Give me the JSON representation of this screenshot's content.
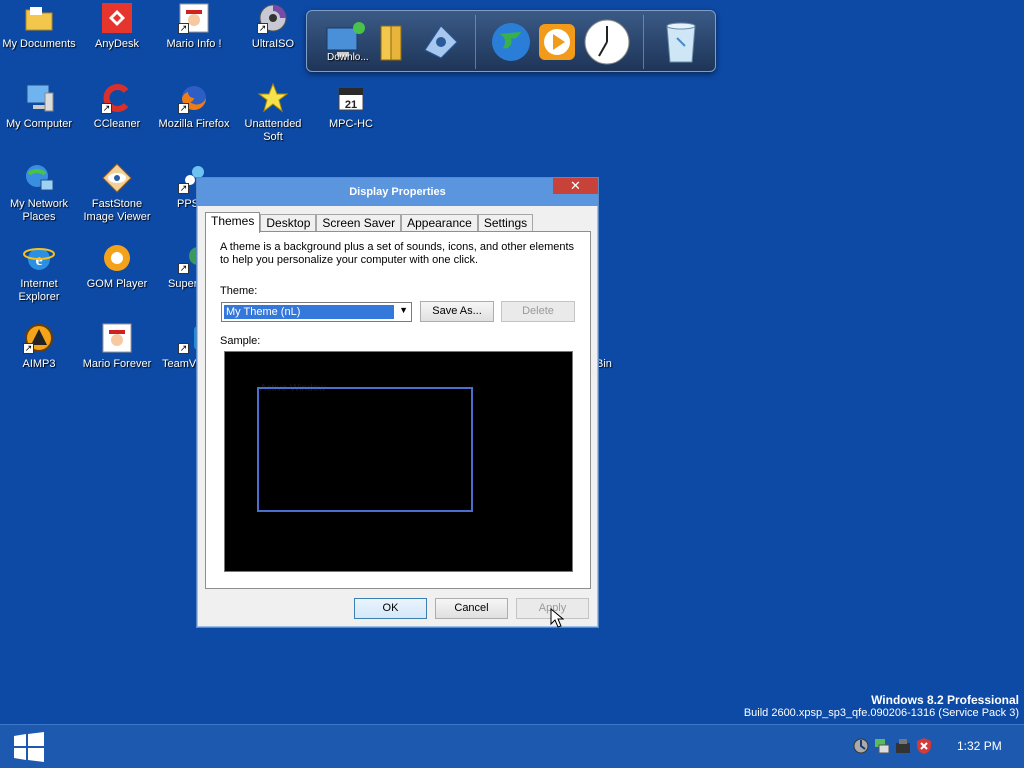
{
  "desktop": {
    "icons": [
      {
        "label": "My Documents",
        "icon": "folder-icon"
      },
      {
        "label": "AnyDesk",
        "icon": "anydesk-icon"
      },
      {
        "label": "Mario Info !",
        "icon": "mario-icon"
      },
      {
        "label": "UltraISO",
        "icon": "disc-icon"
      },
      {
        "label": "My Computer",
        "icon": "computer-icon"
      },
      {
        "label": "CCleaner",
        "icon": "ccleaner-icon"
      },
      {
        "label": "Mozilla Firefox",
        "icon": "firefox-icon"
      },
      {
        "label": "Unattended Soft",
        "icon": "star-icon"
      },
      {
        "label": "MPC-HC",
        "icon": "calendar-icon"
      },
      {
        "label": "My Network Places",
        "icon": "network-icon"
      },
      {
        "label": "FastStone Image Viewer",
        "icon": "eye-icon"
      },
      {
        "label": "PPS",
        "icon": "pps-icon"
      },
      {
        "label": "Internet Explorer",
        "icon": "ie-icon"
      },
      {
        "label": "GOM Player",
        "icon": "gom-icon"
      },
      {
        "label": "Super",
        "icon": "super-icon"
      },
      {
        "label": "AIMP3",
        "icon": "aimp-icon"
      },
      {
        "label": "Mario Forever",
        "icon": "mario-icon"
      },
      {
        "label": "TeamVi",
        "icon": "teamviewer-icon"
      },
      {
        "label": "Bin",
        "icon": "recycle-bin-icon"
      }
    ]
  },
  "dock": {
    "partial_label": "Downlo..."
  },
  "dialog": {
    "title": "Display Properties",
    "close": "✕",
    "tabs": [
      "Themes",
      "Desktop",
      "Screen Saver",
      "Appearance",
      "Settings"
    ],
    "description": "A theme is a background plus a set of sounds, icons, and other elements to help you personalize your computer with one click.",
    "theme_label": "Theme:",
    "theme_value": "My Theme (nL)",
    "save_as": "Save As...",
    "delete": "Delete",
    "sample_label": "Sample:",
    "sample_window_title": "Active Window",
    "ok": "OK",
    "cancel": "Cancel",
    "apply": "Apply"
  },
  "osinfo": {
    "name": "Windows 8.2 Professional",
    "build": "Build 2600.xpsp_sp3_qfe.090206-1316 (Service Pack 3)"
  },
  "taskbar": {
    "clock": "1:32 PM"
  },
  "colors": {
    "desktop": "#0d4aa6",
    "titlebar": "#5b95dd",
    "close": "#c7433a",
    "taskbar": "#1d5aaf"
  }
}
